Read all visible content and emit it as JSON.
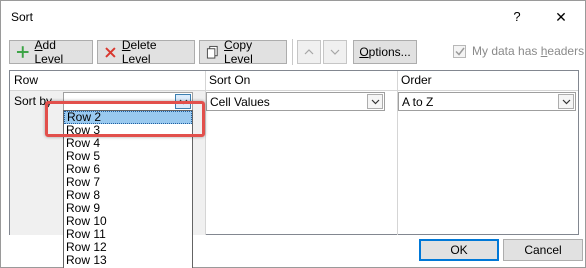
{
  "window": {
    "title": "Sort",
    "help_label": "?",
    "close_label": "✕"
  },
  "toolbar": {
    "add_level": {
      "pre": "",
      "u": "A",
      "post": "dd Level",
      "icon": "plus-icon",
      "icon_color": "#3aa344"
    },
    "delete_level": {
      "pre": "",
      "u": "D",
      "post": "elete Level",
      "icon": "x-icon",
      "icon_color": "#d9382f"
    },
    "copy_level": {
      "pre": "",
      "u": "C",
      "post": "opy Level",
      "icon": "copy-icon"
    },
    "move_up": {
      "icon": "arrow-up-icon"
    },
    "move_down": {
      "icon": "arrow-down-icon"
    },
    "options": {
      "pre": "",
      "u": "O",
      "post": "ptions..."
    },
    "headers_checkbox": {
      "pre": "My data has ",
      "u": "h",
      "post": "eaders",
      "checked": true,
      "disabled": true
    }
  },
  "grid": {
    "headers": {
      "column": "Row",
      "sort_on": "Sort On",
      "order": "Order"
    },
    "level": {
      "label": "Sort by",
      "column_value": "",
      "sort_on_value": "Cell Values",
      "order_value": "A to Z"
    }
  },
  "dropdown": {
    "selected": "Row 2",
    "options": [
      "Row 2",
      "Row 3",
      "Row 4",
      "Row 5",
      "Row 6",
      "Row 7",
      "Row 8",
      "Row 9",
      "Row 10",
      "Row 11",
      "Row 12",
      "Row 13"
    ]
  },
  "buttons": {
    "ok": "OK",
    "cancel": "Cancel"
  },
  "colors": {
    "highlight": "#e2504c",
    "selection": "#99c9ef",
    "accent": "#0078d7"
  }
}
